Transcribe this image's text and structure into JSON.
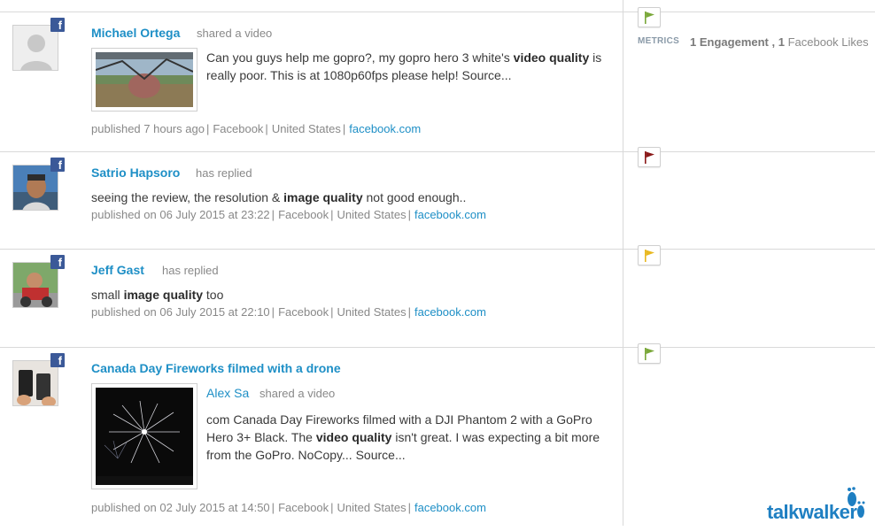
{
  "posts": [
    {
      "author": "Michael Ortega",
      "action": "shared a video",
      "text_parts": [
        "Can you guys help me gopro?, my gopro hero 3 white's ",
        "video quality",
        " is really poor. This is at 1080p60fps please help! Source..."
      ],
      "meta": {
        "published": "published 7 hours ago",
        "source": "Facebook",
        "country": "United States",
        "domain": "facebook.com"
      },
      "flag_color": "#7aa83a",
      "metrics": {
        "label": "METRICS",
        "engagement_count": "1",
        "engagement_label": "Engagement ,",
        "likes_count": "1",
        "likes_label": "Facebook Likes"
      }
    },
    {
      "author": "Satrio Hapsoro",
      "action": "has replied",
      "text_parts": [
        "seeing the review, the resolution & ",
        "image quality",
        " not good enough.."
      ],
      "meta": {
        "published": "published on 06 July 2015 at 23:22",
        "source": "Facebook",
        "country": "United States",
        "domain": "facebook.com"
      },
      "flag_color": "#8b1a1a"
    },
    {
      "author": "Jeff Gast",
      "action": "has replied",
      "text_parts": [
        "small ",
        "image quality",
        " too"
      ],
      "meta": {
        "published": "published on 06 July 2015 at 22:10",
        "source": "Facebook",
        "country": "United States",
        "domain": "facebook.com"
      },
      "flag_color": "#e8b820"
    },
    {
      "author": "Canada Day Fireworks filmed with a drone",
      "shared_author": "Alex Sa",
      "action": "shared a video",
      "text_parts": [
        "com Canada Day Fireworks filmed with a DJI Phantom 2 with a GoPro Hero 3+ Black. The ",
        "video quality",
        " isn't great. I was expecting a bit more from the GoPro. NoCopy... Source..."
      ],
      "meta": {
        "published": "published on 02 July 2015 at 14:50",
        "source": "Facebook",
        "country": "United States",
        "domain": "facebook.com"
      },
      "flag_color": "#7aa83a"
    }
  ],
  "social_badge": "f",
  "logo": {
    "text": "talkwalker"
  }
}
